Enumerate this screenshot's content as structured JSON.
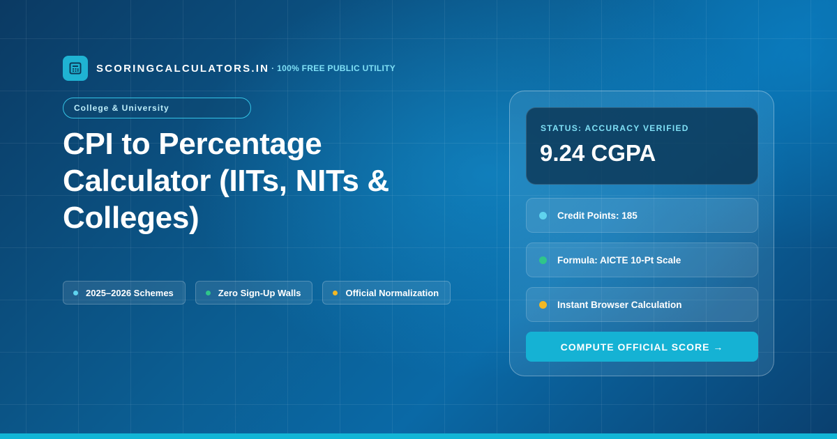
{
  "brand": {
    "name": "SCORINGCALCULATORS.IN",
    "separator": "·",
    "tagline": "100% FREE PUBLIC UTILITY",
    "logo_icon": "calculator-icon"
  },
  "hero": {
    "category": "College & University",
    "title": "CPI to Percentage Calculator (IITs, NITs & Colleges)"
  },
  "features": [
    {
      "label": "2025–2026 Schemes",
      "dot_color": "#5fd3ee"
    },
    {
      "label": "Zero Sign-Up Walls",
      "dot_color": "#2fc58a"
    },
    {
      "label": "Official Normalization",
      "dot_color": "#f2b824"
    }
  ],
  "card": {
    "status_label": "STATUS: ACCURACY VERIFIED",
    "status_value": "9.24 CGPA",
    "rows": [
      {
        "label": "Credit Points: 185",
        "dot_color": "#5fd3ee"
      },
      {
        "label": "Formula: AICTE 10-Pt Scale",
        "dot_color": "#2fc58a"
      },
      {
        "label": "Instant Browser Calculation",
        "dot_color": "#f2b824"
      }
    ],
    "cta_label": "COMPUTE OFFICIAL SCORE →"
  },
  "colors": {
    "accent": "#15b2d4",
    "accent_text": "#7fe0f6"
  }
}
